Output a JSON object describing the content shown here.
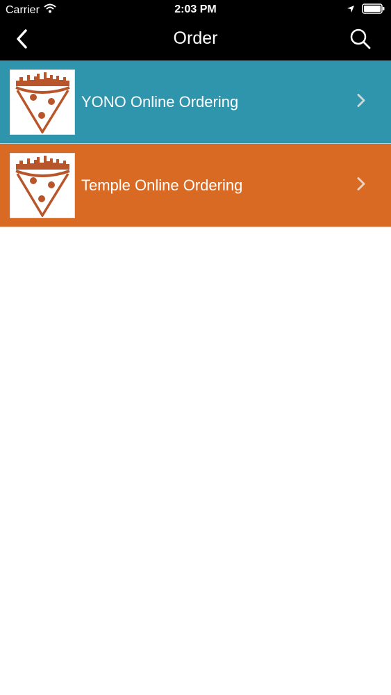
{
  "status_bar": {
    "carrier": "Carrier",
    "time": "2:03 PM"
  },
  "nav": {
    "title": "Order",
    "back_icon": "chevron-left-icon",
    "search_icon": "search-icon"
  },
  "list": {
    "items": [
      {
        "label": "YONO Online Ordering",
        "bg_color": "#2f95ad",
        "icon": "pizza-slice-logo"
      },
      {
        "label": "Temple Online Ordering",
        "bg_color": "#d96a24",
        "icon": "pizza-slice-logo"
      }
    ]
  },
  "colors": {
    "header_bg": "#000000",
    "logo_brand": "#b9552a"
  }
}
